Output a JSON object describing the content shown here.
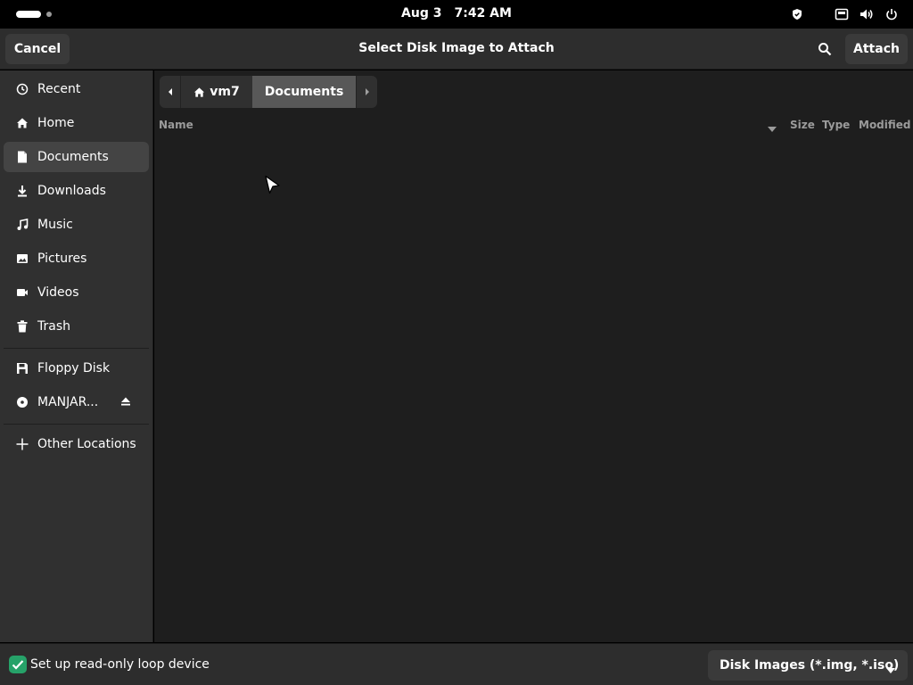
{
  "topbar": {
    "date": "Aug 3",
    "time": "7:42 AM",
    "icons": [
      "shield-icon",
      "network-icon",
      "volume-icon",
      "power-icon"
    ]
  },
  "header": {
    "title": "Select Disk Image to Attach",
    "cancel_label": "Cancel",
    "attach_label": "Attach",
    "search_icon": "search-icon"
  },
  "sidebar": {
    "places": [
      {
        "label": "Recent",
        "icon": "clock-icon"
      },
      {
        "label": "Home",
        "icon": "home-icon"
      },
      {
        "label": "Documents",
        "icon": "document-icon",
        "active": true
      },
      {
        "label": "Downloads",
        "icon": "download-icon"
      },
      {
        "label": "Music",
        "icon": "music-icon"
      },
      {
        "label": "Pictures",
        "icon": "picture-icon"
      },
      {
        "label": "Videos",
        "icon": "video-icon"
      },
      {
        "label": "Trash",
        "icon": "trash-icon"
      }
    ],
    "devices": [
      {
        "label": "Floppy Disk",
        "icon": "floppy-icon"
      },
      {
        "label": "MANJAR...",
        "icon": "disc-icon",
        "ejectable": true
      }
    ],
    "other": {
      "label": "Other Locations",
      "icon": "plus-icon"
    }
  },
  "pathbar": {
    "home_label": "vm7",
    "current_label": "Documents"
  },
  "columns": {
    "name": "Name",
    "size": "Size",
    "type": "Type",
    "modified": "Modified"
  },
  "files": [],
  "bottom": {
    "readonly_label": "Set up read-only loop device",
    "readonly_checked": true,
    "filter_label": "Disk Images (*.img, *.iso)"
  },
  "colors": {
    "accent": "#26a269",
    "selected_row": "#444444",
    "background": "#1e1e1e"
  }
}
